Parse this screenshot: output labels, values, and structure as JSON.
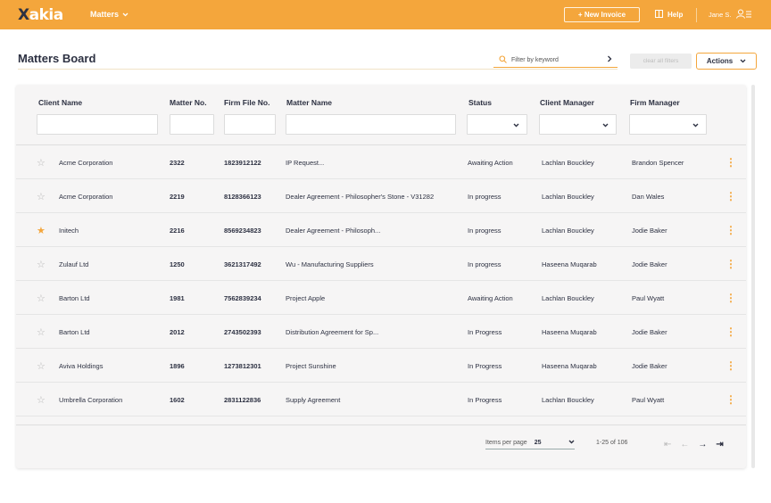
{
  "app": {
    "logo": "Xakia",
    "nav_menu": "Matters",
    "new_invoice": "+ New Invoice",
    "help": "Help",
    "user": "Jane S.",
    "brand_color": "#f4a63c"
  },
  "page": {
    "title": "Matters Board",
    "filter_placeholder": "Filter by keyword",
    "clear_filters": "clear all filters",
    "actions": "Actions"
  },
  "table": {
    "headers": [
      "Client Name",
      "Matter No.",
      "Firm File No.",
      "Matter Name",
      "Status",
      "Client Manager",
      "Firm Manager"
    ],
    "rows": [
      {
        "starred": false,
        "client": "Acme Corporation",
        "matter_no": "2322",
        "file_no": "1823912122",
        "matter": "IP Request...",
        "status": "Awaiting Action",
        "client_mgr": "Lachlan Bouckley",
        "firm_mgr": "Brandon Spencer"
      },
      {
        "starred": false,
        "client": "Acme Corporation",
        "matter_no": "2219",
        "file_no": "8128366123",
        "matter": "Dealer Agreement - Philosopher's Stone - V31282",
        "status": "In progress",
        "client_mgr": "Lachlan Bouckley",
        "firm_mgr": "Dan Wales"
      },
      {
        "starred": true,
        "client": "Initech",
        "matter_no": "2216",
        "file_no": "8569234823",
        "matter": "Dealer Agreement - Philosoph...",
        "status": "In progress",
        "client_mgr": "Lachlan Bouckley",
        "firm_mgr": "Jodie Baker"
      },
      {
        "starred": false,
        "client": "Zulauf Ltd",
        "matter_no": "1250",
        "file_no": "3621317492",
        "matter": "Wu - Manufacturing Suppliers",
        "status": "In progress",
        "client_mgr": "Haseena Muqarab",
        "firm_mgr": "Jodie Baker"
      },
      {
        "starred": false,
        "client": "Barton Ltd",
        "matter_no": "1981",
        "file_no": "7562839234",
        "matter": "Project Apple",
        "status": "Awaiting Action",
        "client_mgr": "Lachlan Bouckley",
        "firm_mgr": "Paul Wyatt"
      },
      {
        "starred": false,
        "client": "Barton Ltd",
        "matter_no": "2012",
        "file_no": "2743502393",
        "matter": "Distribution Agreement for Sp...",
        "status": "In Progress",
        "client_mgr": "Haseena Muqarab",
        "firm_mgr": "Jodie Baker"
      },
      {
        "starred": false,
        "client": "Aviva Holdings",
        "matter_no": "1896",
        "file_no": "1273812301",
        "matter": "Project Sunshine",
        "status": "In Progress",
        "client_mgr": "Haseena Muqarab",
        "firm_mgr": "Jodie Baker"
      },
      {
        "starred": false,
        "client": "Umbrella Corporation",
        "matter_no": "1602",
        "file_no": "2831122836",
        "matter": "Supply Agreement",
        "status": "In Progress",
        "client_mgr": "Lachlan Bouckley",
        "firm_mgr": "Paul Wyatt"
      }
    ]
  },
  "pagination": {
    "items_per_page_label": "Items per page",
    "items_per_page": "25",
    "range": "1-25 of 106"
  }
}
